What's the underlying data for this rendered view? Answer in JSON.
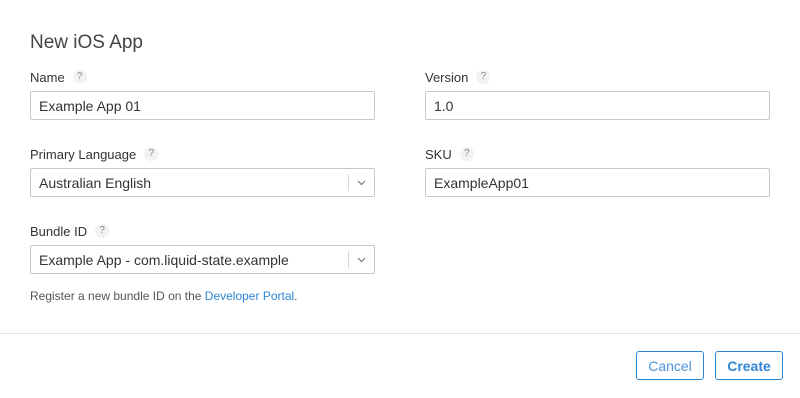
{
  "dialog": {
    "title": "New iOS App",
    "help_glyph": "?"
  },
  "fields": {
    "name": {
      "label": "Name",
      "value": "Example App 01"
    },
    "version": {
      "label": "Version",
      "value": "1.0"
    },
    "primary_language": {
      "label": "Primary Language",
      "value": "Australian English"
    },
    "sku": {
      "label": "SKU",
      "value": "ExampleApp01"
    },
    "bundle_id": {
      "label": "Bundle ID",
      "value": "Example App - com.liquid-state.example"
    }
  },
  "bundle_help": {
    "prefix": "Register a new bundle ID on the ",
    "link": "Developer Portal",
    "suffix": "."
  },
  "buttons": {
    "cancel": "Cancel",
    "create": "Create"
  },
  "icons": {
    "help": "question-mark-icon",
    "dropdown": "chevron-down-icon"
  },
  "colors": {
    "accent": "#2f86d6",
    "border": "#c8c8c8",
    "text": "#333333"
  }
}
